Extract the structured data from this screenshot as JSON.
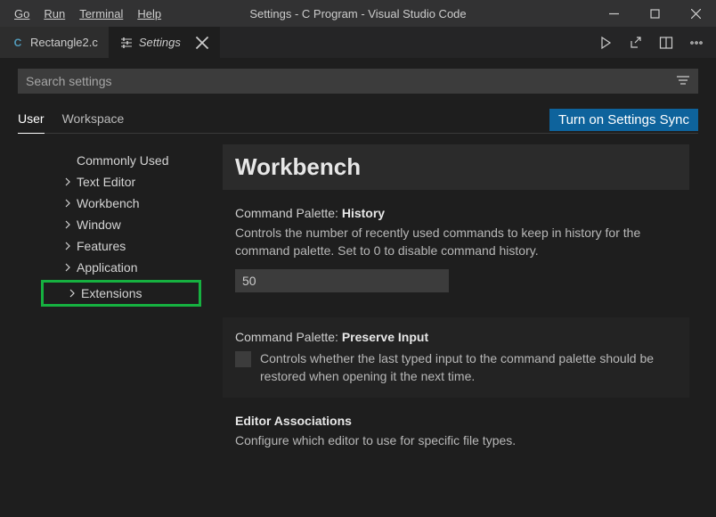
{
  "window": {
    "title": "Settings - C Program - Visual Studio Code",
    "menu": [
      "Go",
      "Run",
      "Terminal",
      "Help"
    ]
  },
  "tabs": {
    "file_tab": {
      "icon_text": "C",
      "icon_color": "#519aba",
      "label": "Rectangle2.c"
    },
    "settings_tab": {
      "label": "Settings"
    }
  },
  "search": {
    "placeholder": "Search settings"
  },
  "scopes": {
    "user": "User",
    "workspace": "Workspace",
    "sync_button": "Turn on Settings Sync"
  },
  "toc": {
    "commonly_used": "Commonly Used",
    "text_editor": "Text Editor",
    "workbench": "Workbench",
    "window": "Window",
    "features": "Features",
    "application": "Application",
    "extensions": "Extensions"
  },
  "content": {
    "header": "Workbench",
    "cmd_history": {
      "prefix": "Command Palette: ",
      "name": "History",
      "desc": "Controls the number of recently used commands to keep in history for the command palette. Set to 0 to disable command history.",
      "value": "50"
    },
    "cmd_preserve": {
      "prefix": "Command Palette: ",
      "name": "Preserve Input",
      "desc": "Controls whether the last typed input to the command palette should be restored when opening it the next time."
    },
    "editor_assoc": {
      "name": "Editor Associations",
      "desc": "Configure which editor to use for specific file types."
    }
  }
}
